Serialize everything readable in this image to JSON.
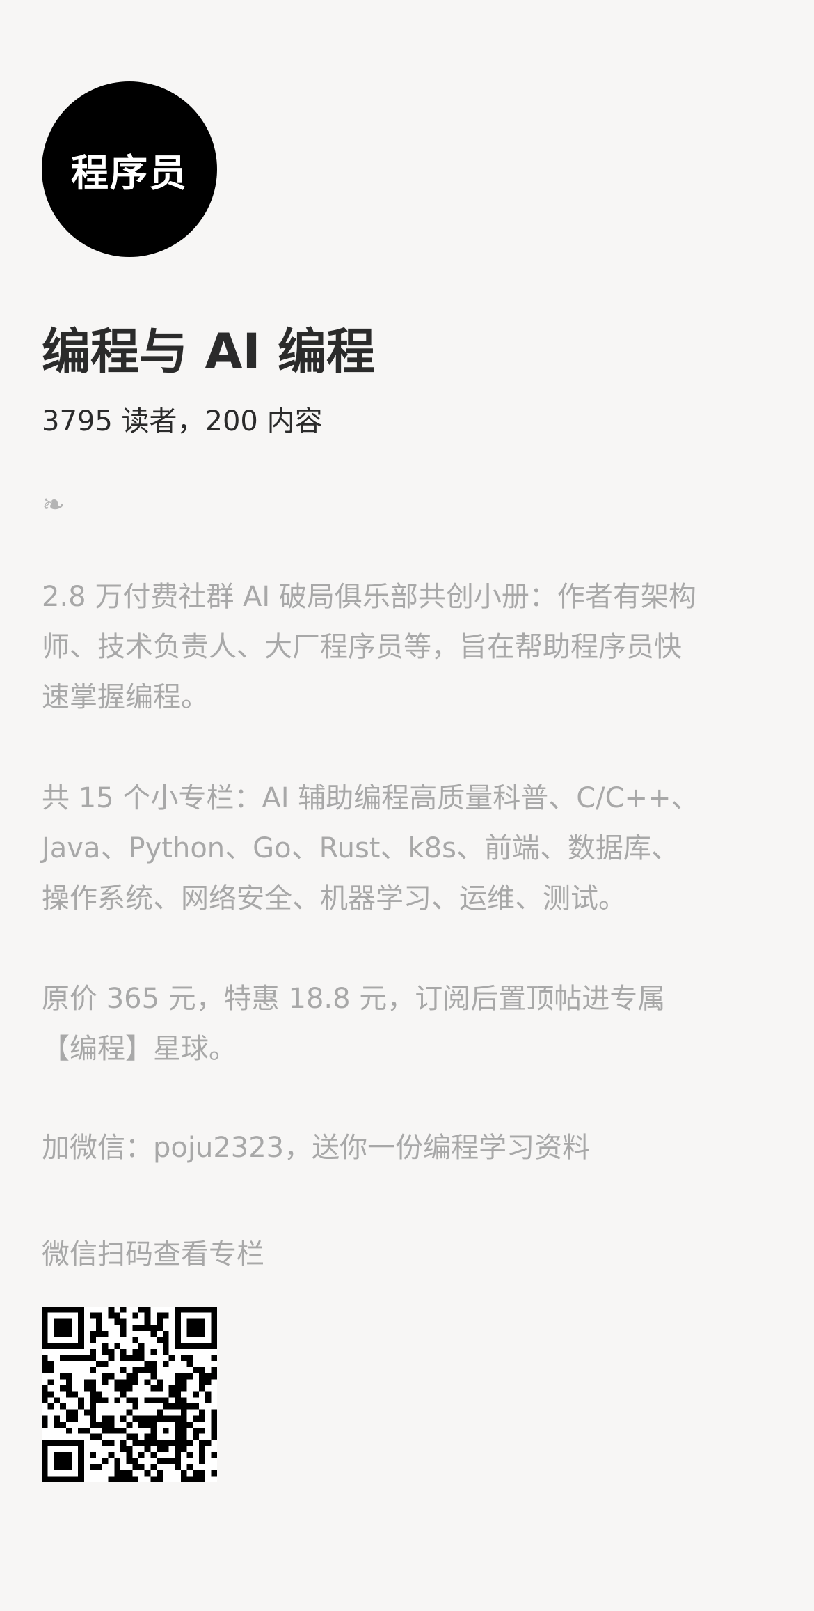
{
  "profile": {
    "avatar_text": "程序员",
    "title": "编程与 AI 编程",
    "stats": "3795 读者，200 内容",
    "fleuron": "❧"
  },
  "description": {
    "p1": [
      "2.8 万付费社群 AI 破局俱乐部共创小册：作者有架构",
      "师、技术负责人、大厂程序员等，旨在帮助程序员快",
      "速掌握编程。"
    ],
    "p2": [
      "共 15 个小专栏：AI 辅助编程高质量科普、C/C++、",
      "Java、Python、Go、Rust、k8s、前端、数据库、",
      "操作系统、网络安全、机器学习、运维、测试。"
    ],
    "p3": [
      "原价 365 元，特惠 18.8 元，订阅后置顶帖进专属",
      "【编程】星球。"
    ],
    "p4": "加微信：poju2323，送你一份编程学习资料",
    "scan_hint": "微信扫码查看专栏"
  },
  "qr_code": {
    "icon": "qr-code-icon"
  }
}
